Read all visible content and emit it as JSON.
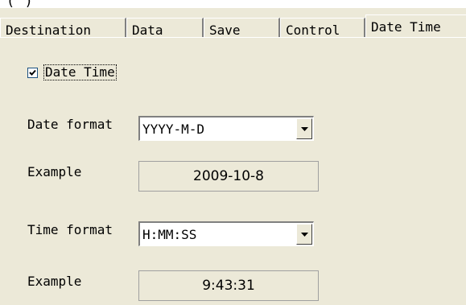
{
  "top_fragment": "( )",
  "tabs": [
    {
      "label": "Destination"
    },
    {
      "label": "Data"
    },
    {
      "label": "Save"
    },
    {
      "label": "Control"
    },
    {
      "label": "Date Time"
    }
  ],
  "active_tab": "Date Time",
  "date_time_checkbox": {
    "label": "Date Time",
    "checked": true
  },
  "date_format": {
    "label": "Date format",
    "value": "YYYY-M-D"
  },
  "date_example": {
    "label": "Example",
    "value": "2009-10-8"
  },
  "time_format": {
    "label": "Time format",
    "value": "H:MM:SS"
  },
  "time_example": {
    "label": "Example",
    "value": "9:43:31"
  },
  "colors": {
    "panel": "#ece9d8",
    "border_dark": "#808080",
    "highlight": "#ffffff"
  }
}
